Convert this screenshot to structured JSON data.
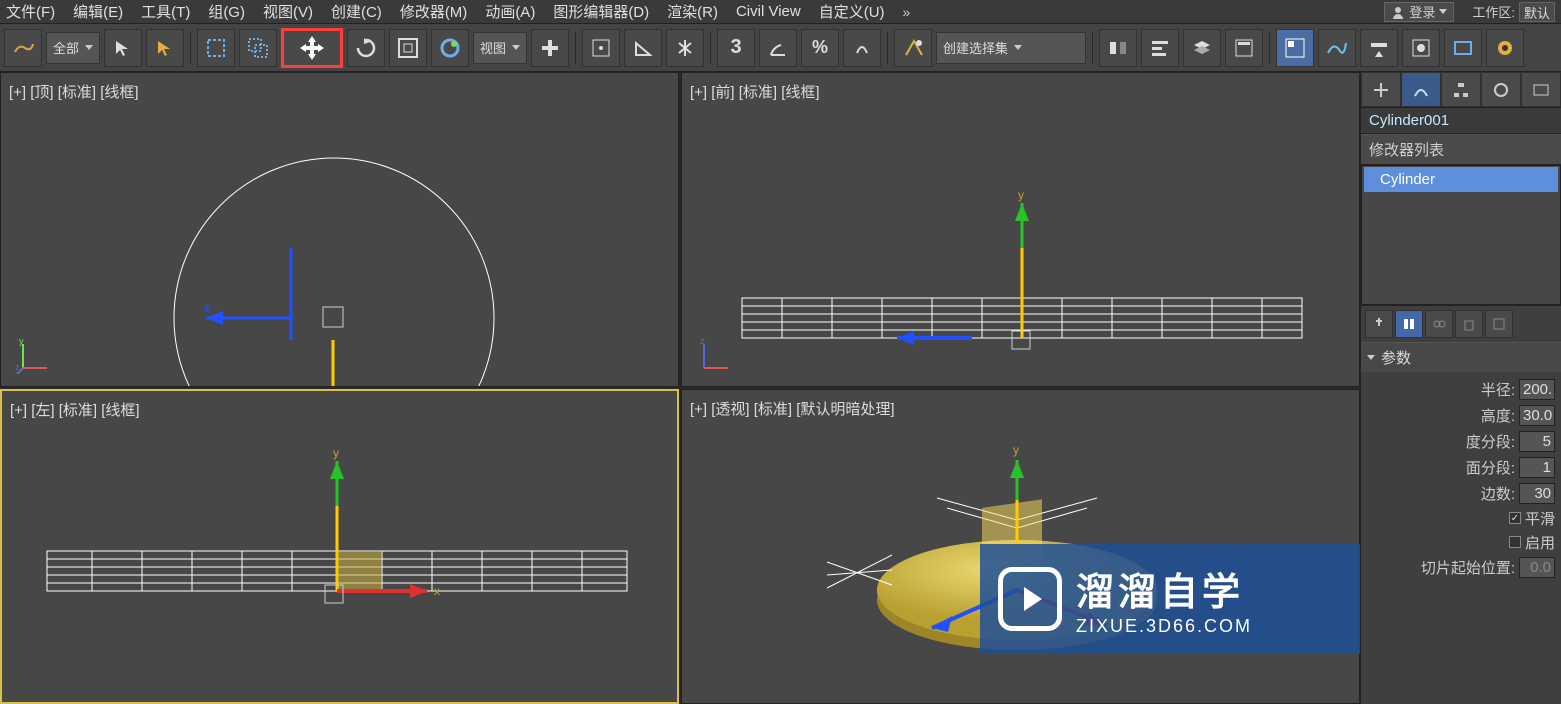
{
  "menu": {
    "items": [
      "文件(F)",
      "编辑(E)",
      "工具(T)",
      "组(G)",
      "视图(V)",
      "创建(C)",
      "修改器(M)",
      "动画(A)",
      "图形编辑器(D)",
      "渲染(R)",
      "Civil View",
      "自定义(U)"
    ],
    "more": "»",
    "signin": "登录",
    "workspace_label": "工作区:",
    "workspace_value": "默认"
  },
  "toolbar": {
    "filter_sel": "全部",
    "view_sel": "视图",
    "named_sel": "创建选择集"
  },
  "viewports": [
    {
      "label": "[+] [顶] [标准] [线框]"
    },
    {
      "label": "[+] [前] [标准] [线框]"
    },
    {
      "label": "[+] [左] [标准] [线框]"
    },
    {
      "label": "[+] [透视] [标准] [默认明暗处理]"
    }
  ],
  "panel": {
    "object_name": "Cylinder001",
    "mod_list_header": "修改器列表",
    "mod_item": "Cylinder",
    "rollout_params": "参数",
    "params": {
      "radius_label": "半径:",
      "radius_val": "200.",
      "height_label": "高度:",
      "height_val": "30.0",
      "hseg_label": "度分段:",
      "hseg_val": "5",
      "cseg_label": "面分段:",
      "cseg_val": "1",
      "sides_label": "边数:",
      "sides_val": "30",
      "smooth_label": "平滑",
      "enable_label": "启用",
      "slice_from_label": "切片起始位置:",
      "slice_from_val": "0.0"
    }
  },
  "watermark": {
    "line1": "溜溜自学",
    "line2": "ZIXUE.3D66.COM"
  }
}
